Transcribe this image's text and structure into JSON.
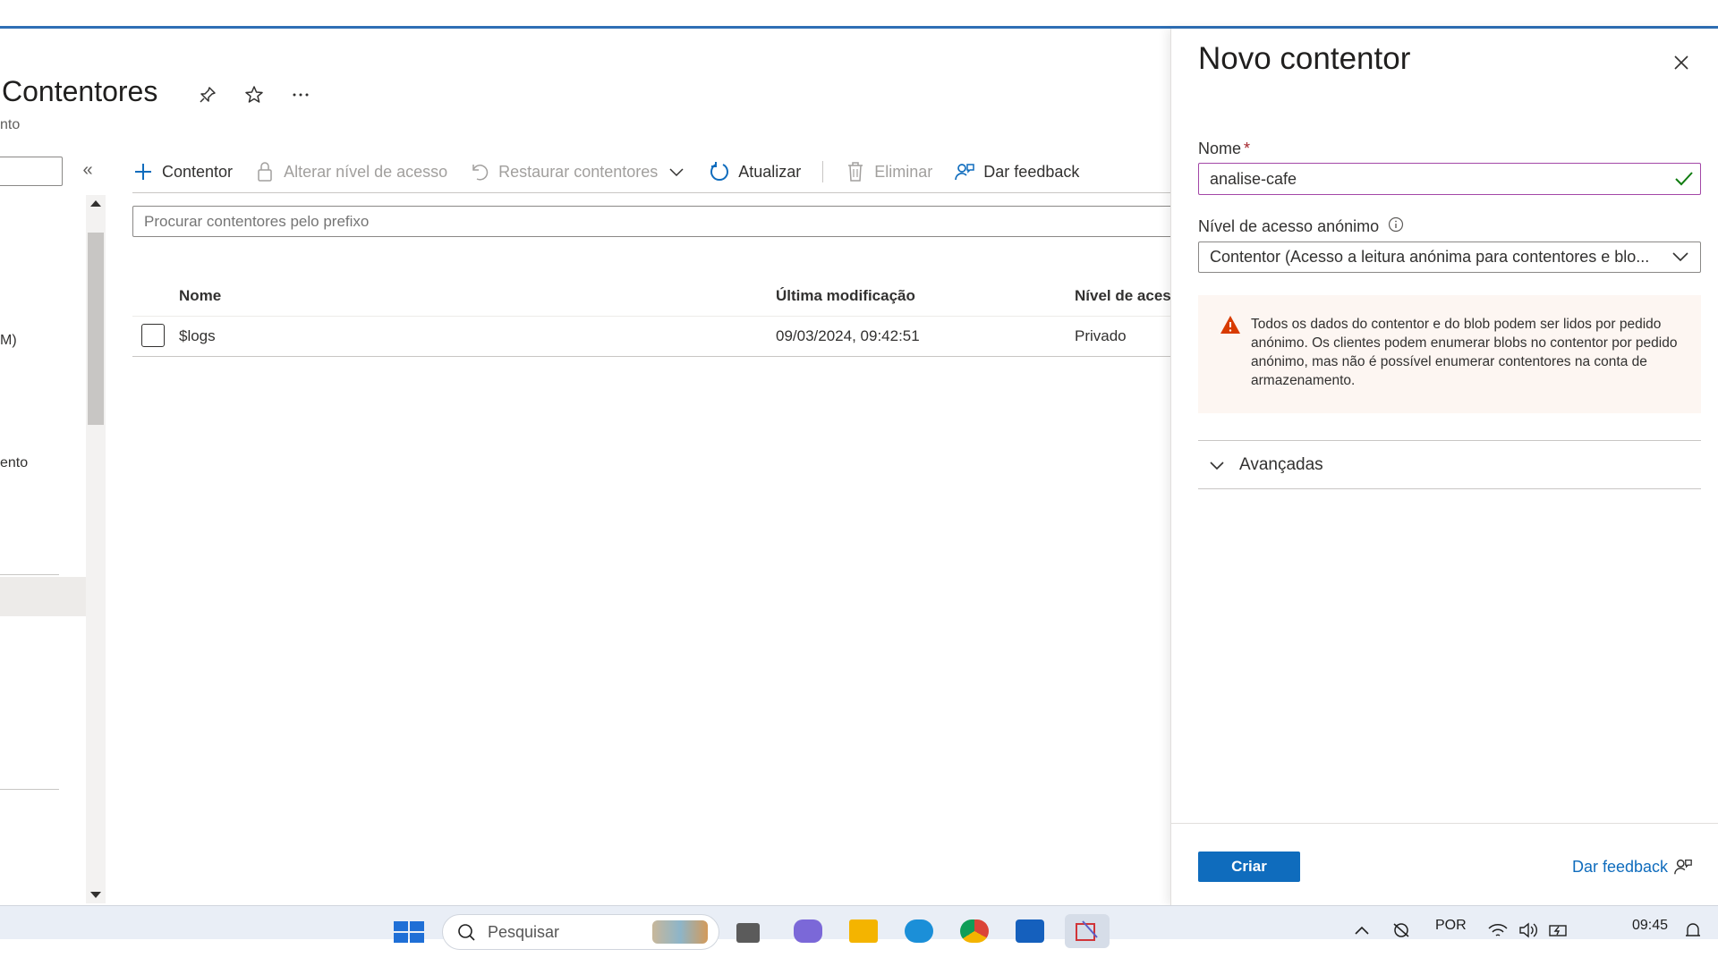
{
  "page": {
    "title": "Contentores",
    "subtitle": "nto",
    "colors": {
      "accent": "#0f6cbd",
      "top_line": "#2f6fb5",
      "valid_border": "#a347a7",
      "warning_icon": "#d83b01",
      "warning_bg": "#fdf6f2"
    }
  },
  "sidebar": {
    "items": [
      {
        "label": "M)"
      },
      {
        "label": "ento"
      }
    ]
  },
  "toolbar": {
    "add_label": "Contentor",
    "access_label": "Alterar nível de acesso",
    "restore_label": "Restaurar contentores",
    "refresh_label": "Atualizar",
    "delete_label": "Eliminar",
    "feedback_label": "Dar feedback"
  },
  "search": {
    "placeholder": "Procurar contentores pelo prefixo"
  },
  "table": {
    "columns": [
      "Nome",
      "Última modificação",
      "Nível de aces"
    ],
    "rows": [
      {
        "name": "$logs",
        "modified": "09/03/2024, 09:42:51",
        "access": "Privado"
      }
    ]
  },
  "panel": {
    "title": "Novo contentor",
    "name_label": "Nome",
    "name_required": "*",
    "name_value": "analise-cafe",
    "access_label": "Nível de acesso anónimo",
    "access_value": "Contentor (Acesso a leitura anónima para contentores e blo...",
    "warning_text": "Todos os dados do contentor e do blob podem ser lidos por pedido anónimo. Os clientes podem enumerar blobs no contentor por pedido anónimo, mas não é possível enumerar contentores na conta de armazenamento.",
    "advanced_label": "Avançadas",
    "create_label": "Criar",
    "feedback_label": "Dar feedback"
  },
  "taskbar": {
    "search_placeholder": "Pesquisar",
    "language": "POR",
    "time": "09:45"
  }
}
